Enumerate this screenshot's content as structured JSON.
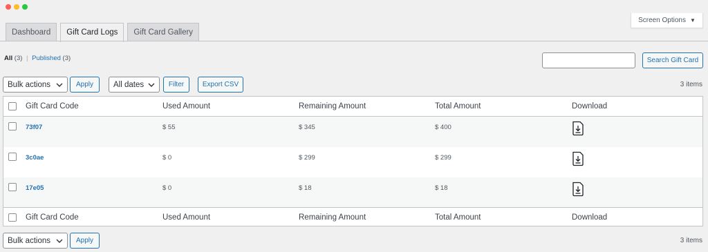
{
  "screen_options": {
    "label": "Screen Options"
  },
  "tabs": [
    {
      "label": "Dashboard"
    },
    {
      "label": "Gift Card Logs"
    },
    {
      "label": "Gift Card Gallery"
    }
  ],
  "filters": {
    "all_label": "All",
    "all_count": "(3)",
    "separator": "|",
    "published_label": "Published",
    "published_count": "(3)"
  },
  "search": {
    "button_label": "Search Gift Card",
    "value": ""
  },
  "toolbar_top": {
    "bulk_actions": "Bulk actions",
    "apply": "Apply",
    "date_filter": "All dates",
    "filter": "Filter",
    "export": "Export CSV",
    "items_count": "3 items"
  },
  "table": {
    "columns": [
      "Gift Card Code",
      "Used Amount",
      "Remaining Amount",
      "Total Amount",
      "Download"
    ],
    "rows": [
      {
        "code": "73f07",
        "used": "$ 55",
        "remaining": "$ 345",
        "total": "$ 400"
      },
      {
        "code": "3c0ae",
        "used": "$ 0",
        "remaining": "$ 299",
        "total": "$ 299"
      },
      {
        "code": "17e05",
        "used": "$ 0",
        "remaining": "$ 18",
        "total": "$ 18"
      }
    ]
  },
  "toolbar_bottom": {
    "bulk_actions": "Bulk actions",
    "apply": "Apply",
    "items_count": "3 items"
  },
  "colors": {
    "accent": "#2271b1",
    "background": "#f0f0f1",
    "border": "#c3c4c7"
  }
}
